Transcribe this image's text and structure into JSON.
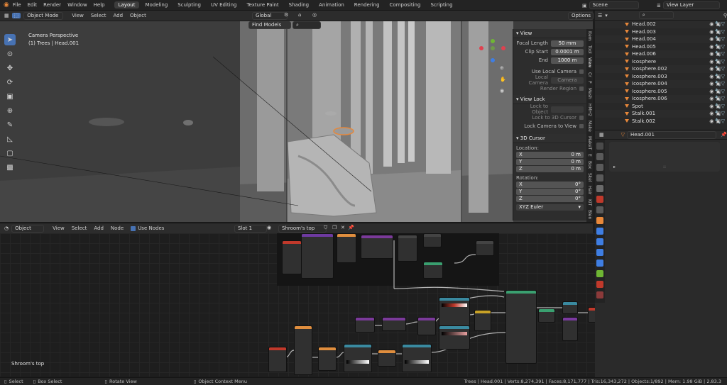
{
  "topbar": {
    "menus": [
      "File",
      "Edit",
      "Render",
      "Window",
      "Help"
    ],
    "workspaces": [
      "Layout",
      "Modeling",
      "Sculpting",
      "UV Editing",
      "Texture Paint",
      "Shading",
      "Animation",
      "Rendering",
      "Compositing",
      "Scripting"
    ],
    "active_workspace": "Layout",
    "scene": "Scene",
    "view_layer": "View Layer"
  },
  "viewport": {
    "mode": "Object Mode",
    "menus": [
      "View",
      "Select",
      "Add",
      "Object"
    ],
    "orientation": "Global",
    "options": "Options",
    "find_models": "Find Models",
    "info_title": "Camera Perspective",
    "info_sub": "(1) Trees | Head.001"
  },
  "npanel": {
    "view_title": "View",
    "focal_label": "Focal Length",
    "focal_value": "50 mm",
    "clip_start_label": "Clip Start",
    "clip_start_value": "0.0001 m",
    "clip_end_label": "End",
    "clip_end_value": "1000 m",
    "use_local_camera": "Use Local Camera",
    "local_camera_label": "Local Camera",
    "local_camera_value": "Camera",
    "render_region": "Render Region",
    "view_lock_title": "View Lock",
    "lock_to_object": "Lock to Object",
    "lock_to_3d_cursor": "Lock to 3D Cursor",
    "lock_camera_to_view": "Lock Camera to View",
    "cursor_title": "3D Cursor",
    "location_label": "Location:",
    "location": [
      {
        "axis": "X",
        "value": "0 m"
      },
      {
        "axis": "Y",
        "value": "0 m"
      },
      {
        "axis": "Z",
        "value": "0 m"
      }
    ],
    "rotation_label": "Rotation:",
    "rotation": [
      {
        "axis": "X",
        "value": "0°"
      },
      {
        "axis": "Y",
        "value": "0°"
      },
      {
        "axis": "Z",
        "value": "0°"
      }
    ],
    "rotation_mode": "XYZ Euler",
    "side_tabs": [
      "Item",
      "Tool",
      "View",
      "Cr",
      "P",
      "Mesh",
      "HMH2",
      "Make",
      "MakeT",
      "E",
      "Box",
      "Skel",
      "Hair",
      "KIT",
      "Blen"
    ]
  },
  "node_editor": {
    "type": "Object",
    "menus": [
      "View",
      "Select",
      "Add",
      "Node"
    ],
    "use_nodes": "Use Nodes",
    "slot": "Slot 1",
    "material": "Shroom's top",
    "frame_label": "Shroom's top"
  },
  "outliner": {
    "items": [
      {
        "name": "Head.002"
      },
      {
        "name": "Head.003"
      },
      {
        "name": "Head.004"
      },
      {
        "name": "Head.005"
      },
      {
        "name": "Head.006"
      },
      {
        "name": "Icosphere"
      },
      {
        "name": "Icosphere.002"
      },
      {
        "name": "Icosphere.003"
      },
      {
        "name": "Icosphere.004"
      },
      {
        "name": "Icosphere.005"
      },
      {
        "name": "Icosphere.006"
      },
      {
        "name": "Spot"
      },
      {
        "name": "Stalk.001"
      },
      {
        "name": "Stalk.002"
      }
    ]
  },
  "properties": {
    "object_name": "Head.001"
  },
  "statusbar": {
    "select": "Select",
    "box_select": "Box Select",
    "rotate_view": "Rotate View",
    "context_menu": "Object Context Menu",
    "stats": "Trees | Head.001 | Verts:8,274,391 | Faces:8,171,777 | Tris:16,343,272 | Objects:1/892 | Mem: 1.98 GiB | 2.83.3"
  },
  "colors": {
    "accent": "#4772b3",
    "object_orange": "#e8883a",
    "axis_x": "#e0414f",
    "axis_y": "#6fb634",
    "axis_z": "#3f7ee3"
  }
}
